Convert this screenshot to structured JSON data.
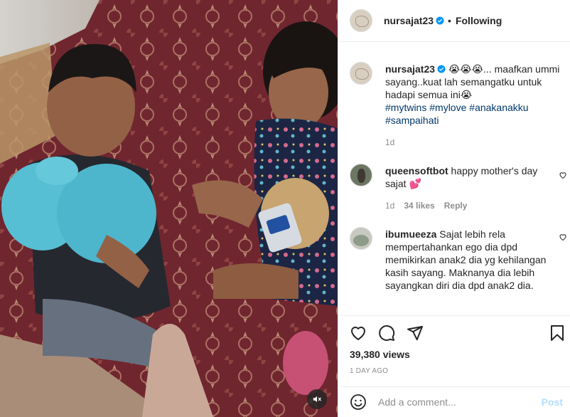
{
  "post": {
    "username": "nursajat23",
    "follow_state": "Following",
    "separator": "•",
    "verified_icon": "verified-badge-icon",
    "caption": {
      "text": "😭😭😭... maafkan ummi sayang..kuat lah semangatku untuk hadapi semua ini😭",
      "hashtags": [
        "#mytwins",
        "#mylove",
        "#anakanakku",
        "#sampaihati"
      ],
      "age": "1d"
    }
  },
  "comments": [
    {
      "username": "queensoftbot",
      "text": "happy mother's day sajat 💕",
      "age": "1d",
      "likes": "34 likes",
      "reply_label": "Reply"
    },
    {
      "username": "ibumueeza",
      "text": "Sajat lebih rela mempertahankan ego dia dpd memikirkan anak2 dia yg kehilangan kasih sayang. Maknanya dia lebih sayangkan diri dia dpd anak2 dia."
    }
  ],
  "stats": {
    "views": "39,380 views",
    "date": "1 DAY AGO"
  },
  "composer": {
    "placeholder": "Add a comment...",
    "post_label": "Post"
  },
  "video": {
    "muted": true,
    "mute_icon": "speaker-muted-icon"
  },
  "colors": {
    "link": "#00376b",
    "verified": "#0095f6",
    "post_disabled": "#b2dffc",
    "muted_text": "#8e8e8e"
  }
}
